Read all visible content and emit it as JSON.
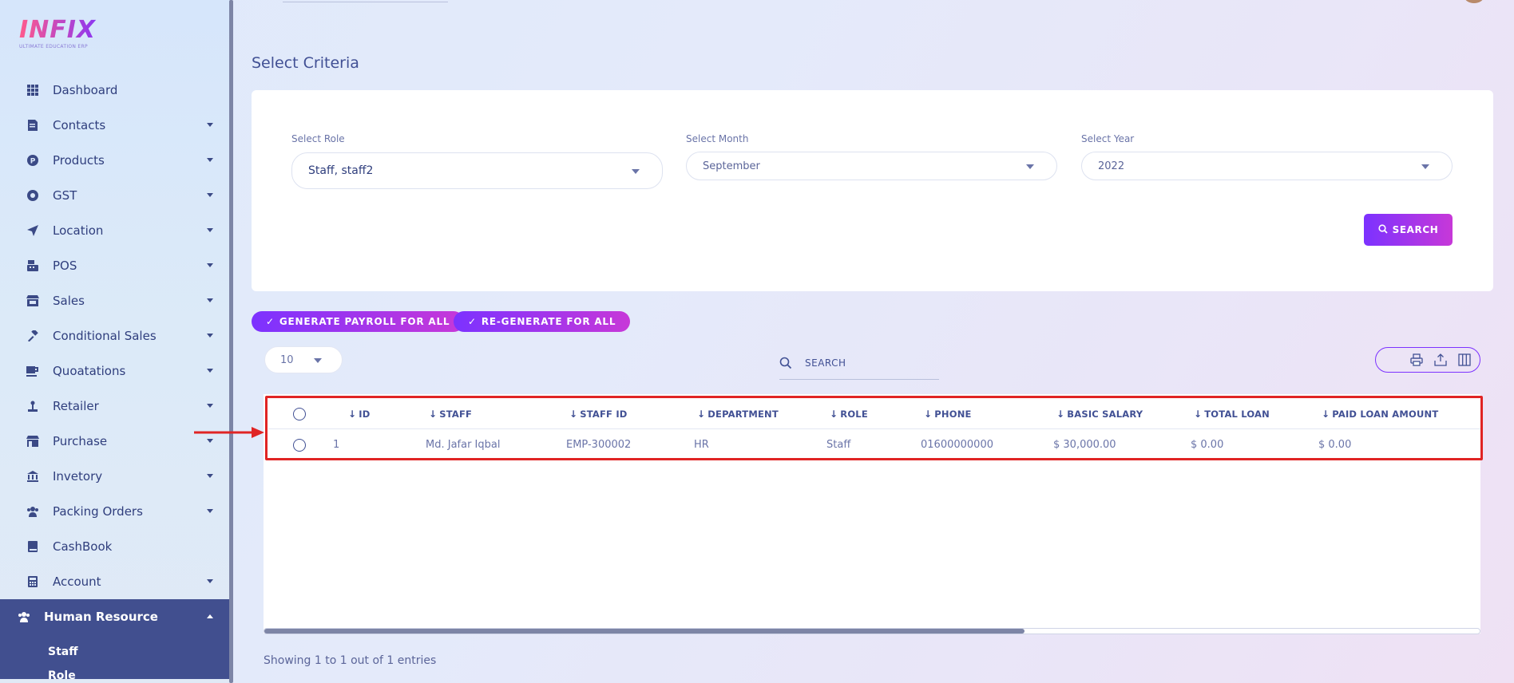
{
  "brand": {
    "name": "INFIX",
    "tagline": "ULTIMATE EDUCATION ERP"
  },
  "sidebar": {
    "items": [
      {
        "label": "Dashboard",
        "icon": "grid-icon",
        "caret": false
      },
      {
        "label": "Contacts",
        "icon": "contacts-icon",
        "caret": true
      },
      {
        "label": "Products",
        "icon": "products-icon",
        "caret": true
      },
      {
        "label": "GST",
        "icon": "gst-icon",
        "caret": true
      },
      {
        "label": "Location",
        "icon": "location-arrow-icon",
        "caret": true
      },
      {
        "label": "POS",
        "icon": "pos-icon",
        "caret": true
      },
      {
        "label": "Sales",
        "icon": "store-icon",
        "caret": true
      },
      {
        "label": "Conditional Sales",
        "icon": "gavel-icon",
        "caret": true
      },
      {
        "label": "Quoatations",
        "icon": "mug-icon",
        "caret": true
      },
      {
        "label": "Retailer",
        "icon": "retailer-icon",
        "caret": true
      },
      {
        "label": "Purchase",
        "icon": "shop-icon",
        "caret": true
      },
      {
        "label": "Invetory",
        "icon": "bank-icon",
        "caret": true
      },
      {
        "label": "Packing Orders",
        "icon": "users-icon",
        "caret": true
      },
      {
        "label": "CashBook",
        "icon": "book-icon",
        "caret": false
      },
      {
        "label": "Account",
        "icon": "calculator-icon",
        "caret": true
      }
    ],
    "active": {
      "label": "Human Resource",
      "icon": "users-icon"
    },
    "sub_items": [
      "Staff",
      "Role"
    ]
  },
  "page": {
    "title": "Select Criteria"
  },
  "criteria": {
    "role_label": "Select Role",
    "role_value": "Staff, staff2",
    "month_label": "Select Month",
    "month_value": "September",
    "year_label": "Select Year",
    "year_value": "2022",
    "search_button": "SEARCH"
  },
  "actions": {
    "generate_all": "GENERATE PAYROLL FOR ALL",
    "regenerate_all": "RE-GENERATE FOR ALL"
  },
  "table_controls": {
    "page_length": "10",
    "search_placeholder": "SEARCH"
  },
  "table": {
    "headers": [
      "ID",
      "STAFF",
      "STAFF ID",
      "DEPARTMENT",
      "ROLE",
      "PHONE",
      "BASIC SALARY",
      "TOTAL LOAN",
      "PAID LOAN AMOUNT"
    ],
    "rows": [
      {
        "id": "1",
        "staff": "Md. Jafar Iqbal",
        "staff_id": "EMP-300002",
        "department": "HR",
        "role": "Staff",
        "phone": "01600000000",
        "basic_salary": "$ 30,000.00",
        "total_loan": "$ 0.00",
        "paid_loan": "$ 0.00"
      }
    ]
  },
  "footer": {
    "entries_text": "Showing 1 to 1 out of 1 entries"
  },
  "colors": {
    "accent": "#7c32ff",
    "accent2": "#c738d8",
    "sidebar_active": "#414f8f",
    "highlight": "#e02424"
  }
}
